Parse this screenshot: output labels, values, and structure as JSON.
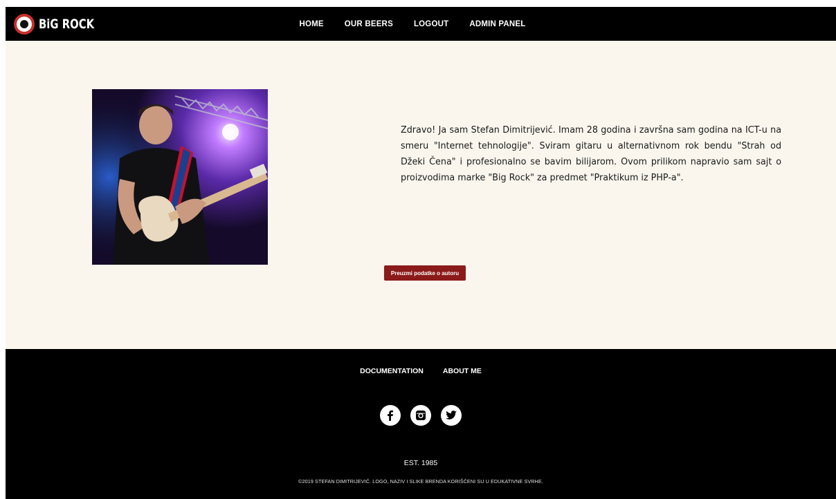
{
  "brand": {
    "logo_text": "BiG ROCK"
  },
  "nav": {
    "items": [
      {
        "label": "HOME"
      },
      {
        "label": "OUR BEERS"
      },
      {
        "label": "LOGOUT"
      },
      {
        "label": "ADMIN PANEL"
      }
    ]
  },
  "main": {
    "bio": "Zdravo! Ja sam Stefan Dimitrijević. Imam 28 godina i završna sam godina na ICT-u na smeru \"Internet tehnologije\". Sviram gitaru u alternativnom rok bendu \"Strah od Džeki Čena\" i profesionalno se bavim bilijarom. Ovom prilikom napravio sam sajt o proizvodima marke \"Big Rock\" za predmet \"Praktikum iz PHP-a\".",
    "download_label": "Preuzmi podatke o autoru"
  },
  "footer": {
    "links": [
      {
        "label": "DOCUMENTATION"
      },
      {
        "label": "ABOUT ME"
      }
    ],
    "socials": [
      "facebook-icon",
      "instagram-icon",
      "twitter-icon"
    ],
    "est": "EST. 1985",
    "copyright": "©2019 STEFAN DIMITRIJEVIĆ. LOGO, NAZIV I SLIKE BRENDA KORIŠĆENI SU U EDUKATIVNE SVRHE."
  },
  "colors": {
    "header_bg": "#000000",
    "main_bg": "#faf6ee",
    "button_bg": "#8b1a1a",
    "logo_red": "#c9302c"
  }
}
